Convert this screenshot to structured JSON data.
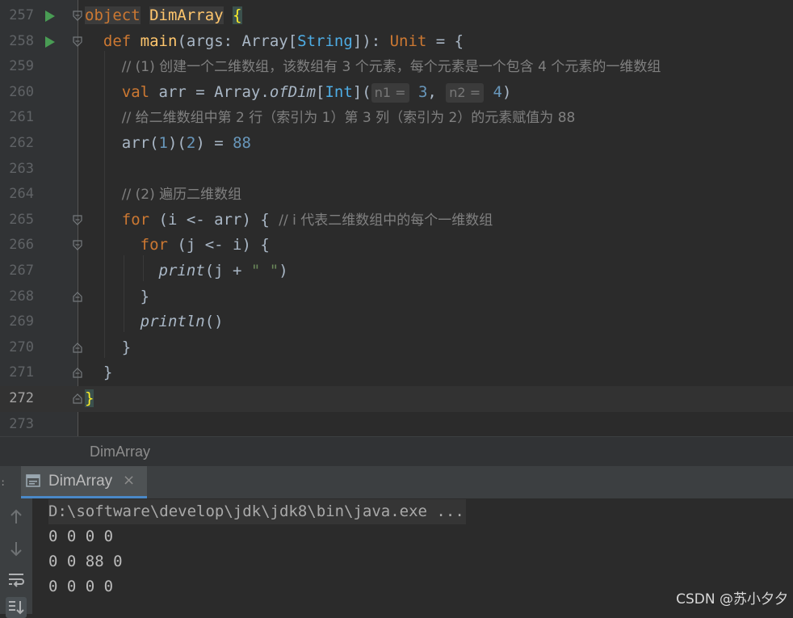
{
  "editor": {
    "lines": [
      {
        "num": "257",
        "run": true,
        "fold": "open-top",
        "current": false,
        "tokens": [
          [
            "obj-hl kw-obj",
            "object"
          ],
          [
            "",
            " "
          ],
          [
            "fn obj-hl",
            "DimArray"
          ],
          [
            "",
            " "
          ],
          [
            "brace-hl",
            "{"
          ]
        ]
      },
      {
        "num": "258",
        "run": true,
        "fold": "open-top",
        "current": false,
        "tokens": [
          [
            "",
            "  "
          ],
          [
            "kw",
            "def"
          ],
          [
            "",
            " "
          ],
          [
            "fn",
            "main"
          ],
          [
            "",
            "(args: "
          ],
          [
            "typ",
            "Array"
          ],
          [
            "",
            "["
          ],
          [
            "green-typ",
            "String"
          ],
          [
            "",
            "]): "
          ],
          [
            "kw",
            "Unit"
          ],
          [
            "",
            " = {"
          ]
        ]
      },
      {
        "num": "259",
        "run": false,
        "fold": "",
        "current": false,
        "tokens": [
          [
            "",
            "    "
          ],
          [
            "cmt",
            "// (1) 创建一个二维数组，该数组有 3 个元素，每个元素是一个包含 4 个元素的一维数组"
          ]
        ]
      },
      {
        "num": "260",
        "run": false,
        "fold": "",
        "current": false,
        "tokens": [
          [
            "",
            "    "
          ],
          [
            "kw",
            "val"
          ],
          [
            "",
            " arr = Array."
          ],
          [
            "it fn-it",
            "ofDim"
          ],
          [
            "",
            "["
          ],
          [
            "green-typ",
            "Int"
          ],
          [
            "",
            "]("
          ],
          [
            "hint",
            "n1 ="
          ],
          [
            "num",
            " 3"
          ],
          [
            "",
            ", "
          ],
          [
            "hint",
            "n2 ="
          ],
          [
            "num",
            " 4"
          ],
          [
            "",
            ")"
          ]
        ]
      },
      {
        "num": "261",
        "run": false,
        "fold": "",
        "current": false,
        "tokens": [
          [
            "",
            "    "
          ],
          [
            "cmt",
            "// 给二维数组中第 2 行（索引为 1）第 3 列（索引为 2）的元素赋值为 88"
          ]
        ]
      },
      {
        "num": "262",
        "run": false,
        "fold": "",
        "current": false,
        "tokens": [
          [
            "",
            "    arr("
          ],
          [
            "num",
            "1"
          ],
          [
            "",
            ")("
          ],
          [
            "num",
            "2"
          ],
          [
            "",
            ") = "
          ],
          [
            "num",
            "88"
          ]
        ]
      },
      {
        "num": "263",
        "run": false,
        "fold": "",
        "current": false,
        "tokens": []
      },
      {
        "num": "264",
        "run": false,
        "fold": "",
        "current": false,
        "tokens": [
          [
            "",
            "    "
          ],
          [
            "cmt",
            "// (2) 遍历二维数组"
          ]
        ]
      },
      {
        "num": "265",
        "run": false,
        "fold": "open-top",
        "current": false,
        "tokens": [
          [
            "",
            "    "
          ],
          [
            "kw",
            "for"
          ],
          [
            "",
            " (i <- arr) { "
          ],
          [
            "cmt",
            "// i 代表二维数组中的每个一维数组"
          ]
        ]
      },
      {
        "num": "266",
        "run": false,
        "fold": "open-top",
        "current": false,
        "tokens": [
          [
            "",
            "      "
          ],
          [
            "kw",
            "for"
          ],
          [
            "",
            " (j <- i) {"
          ]
        ]
      },
      {
        "num": "267",
        "run": false,
        "fold": "",
        "current": false,
        "tokens": [
          [
            "",
            "        "
          ],
          [
            "it",
            "print"
          ],
          [
            "",
            "(j + "
          ],
          [
            "str",
            "\" \""
          ],
          [
            "",
            ")"
          ]
        ]
      },
      {
        "num": "268",
        "run": false,
        "fold": "close-bottom",
        "current": false,
        "tokens": [
          [
            "",
            "      }"
          ]
        ]
      },
      {
        "num": "269",
        "run": false,
        "fold": "",
        "current": false,
        "tokens": [
          [
            "",
            "      "
          ],
          [
            "it",
            "println"
          ],
          [
            "",
            "()"
          ]
        ]
      },
      {
        "num": "270",
        "run": false,
        "fold": "close-bottom",
        "current": false,
        "tokens": [
          [
            "",
            "    }"
          ]
        ]
      },
      {
        "num": "271",
        "run": false,
        "fold": "close-bottom",
        "current": false,
        "tokens": [
          [
            "",
            "  }"
          ]
        ]
      },
      {
        "num": "272",
        "run": false,
        "fold": "close-bottom",
        "current": true,
        "tokens": [
          [
            "brace-hl",
            "}"
          ]
        ]
      },
      {
        "num": "273",
        "run": false,
        "fold": "",
        "current": false,
        "tokens": []
      }
    ]
  },
  "breadcrumb": {
    "label": "DimArray"
  },
  "run_tab": {
    "label": "DimArray",
    "close": "×"
  },
  "console": {
    "command": "D:\\software\\develop\\jdk\\jdk8\\bin\\java.exe ...",
    "output": [
      "0 0 0 0",
      "0 0 88 0",
      "0 0 0 0"
    ]
  },
  "console_toolbar": [
    "up-arrow-icon",
    "down-arrow-icon",
    "soft-wrap-icon",
    "scroll-to-end-icon"
  ],
  "watermark": "CSDN @苏小夕夕",
  "colors": {
    "keyword": "#cc7832",
    "function": "#ffc66d",
    "number": "#6897bb",
    "comment": "#808080",
    "background": "#2b2b2b"
  }
}
